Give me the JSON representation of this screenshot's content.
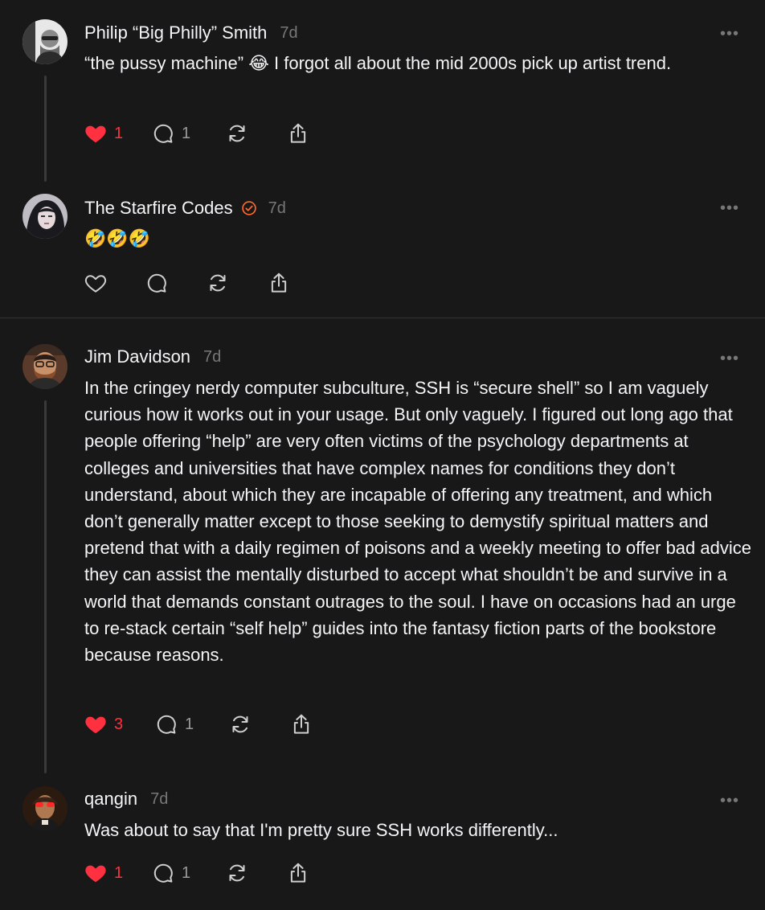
{
  "posts": [
    {
      "author": "Philip “Big Philly” Smith",
      "time": "7d",
      "text": "“the pussy machine” 😂 I forgot all about the mid 2000s pick up artist trend.",
      "likes": "1",
      "replies": "1",
      "liked": true
    },
    {
      "author": "The Starfire Codes",
      "time": "7d",
      "text": "🤣🤣🤣",
      "likes": "",
      "replies": "",
      "liked": false,
      "verified": true
    },
    {
      "author": "Jim Davidson",
      "time": "7d",
      "text": "In the cringey nerdy computer subculture, SSH is “secure shell” so I am vaguely curious how it works out in your usage. But only vaguely. I figured out long ago that people offering “help” are very often victims of the psychology departments at colleges and universities that have complex names for conditions they don’t understand, about which they are incapable of offering any treatment, and which don’t generally matter except to those seeking to demystify spiritual matters and pretend that with a daily regimen of poisons and a weekly meeting to offer bad advice they can assist the mentally disturbed to accept what shouldn’t be and survive in a world that demands constant outrages to the soul. I have on occasions had an urge to re-stack certain “self help” guides into the fantasy fiction parts of the bookstore because reasons.",
      "likes": "3",
      "replies": "1",
      "liked": true
    },
    {
      "author": "qangin",
      "time": "7d",
      "text": "Was about to say that I'm pretty sure SSH works differently...",
      "likes": "1",
      "replies": "1",
      "liked": true
    }
  ],
  "more_label": "•••",
  "colors": {
    "background": "#181818",
    "like": "#ff3040",
    "verified": "#ff6a2a",
    "muted": "#777777"
  }
}
